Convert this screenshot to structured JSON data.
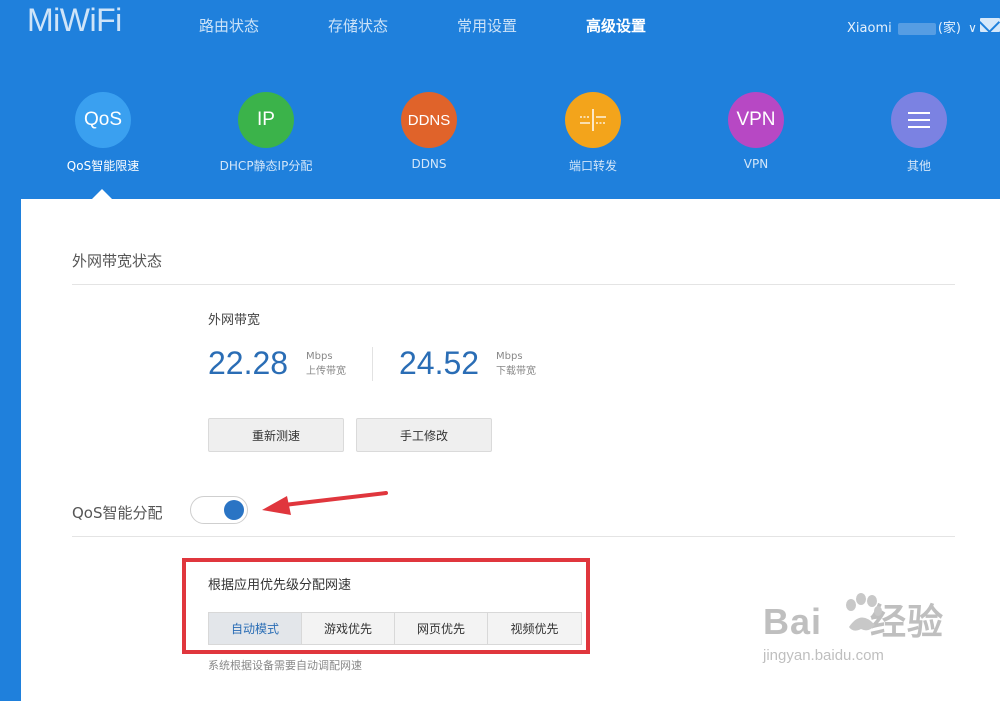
{
  "header": {
    "logo": "MiWiFi",
    "nav": [
      {
        "label": "路由状态"
      },
      {
        "label": "存储状态"
      },
      {
        "label": "常用设置"
      },
      {
        "label": "高级设置",
        "active": true
      }
    ],
    "user_prefix": "Xiaomi",
    "user_suffix": "(家)"
  },
  "apps": [
    {
      "icon_text": "QoS",
      "label": "QoS智能限速",
      "color": "#3aa0f0",
      "active": true
    },
    {
      "icon_text": "IP",
      "label": "DHCP静态IP分配",
      "color": "#3bb34a"
    },
    {
      "icon_text": "DDNS",
      "label": "DDNS",
      "color": "#e0632a"
    },
    {
      "icon_text": "",
      "icon_name": "port-forward-icon",
      "label": "端口转发",
      "color": "#f3a41b"
    },
    {
      "icon_text": "VPN",
      "label": "VPN",
      "color": "#b748c4"
    },
    {
      "icon_text": "",
      "icon_name": "menu-icon",
      "label": "其他",
      "color": "#7b82e2"
    }
  ],
  "bandwidth": {
    "section_title": "外网带宽状态",
    "title": "外网带宽",
    "upload_value": "22.28",
    "upload_unit": "Mbps",
    "upload_label": "上传带宽",
    "download_value": "24.52",
    "download_unit": "Mbps",
    "download_label": "下载带宽",
    "retest_label": "重新测速",
    "manual_label": "手工修改"
  },
  "qos": {
    "section_title": "QoS智能分配",
    "enabled": true,
    "priority_title": "根据应用优先级分配网速",
    "modes": [
      "自动模式",
      "游戏优先",
      "网页优先",
      "视频优先"
    ],
    "selected_mode": "自动模式",
    "hint": "系统根据设备需要自动调配网速"
  },
  "watermark": {
    "brand": "Bai",
    "brand_rest": "经验",
    "url": "jingyan.baidu.com"
  },
  "colors": {
    "header_bg": "#1f80dc",
    "accent": "#2a6db5",
    "annotation_red": "#e0363d"
  }
}
